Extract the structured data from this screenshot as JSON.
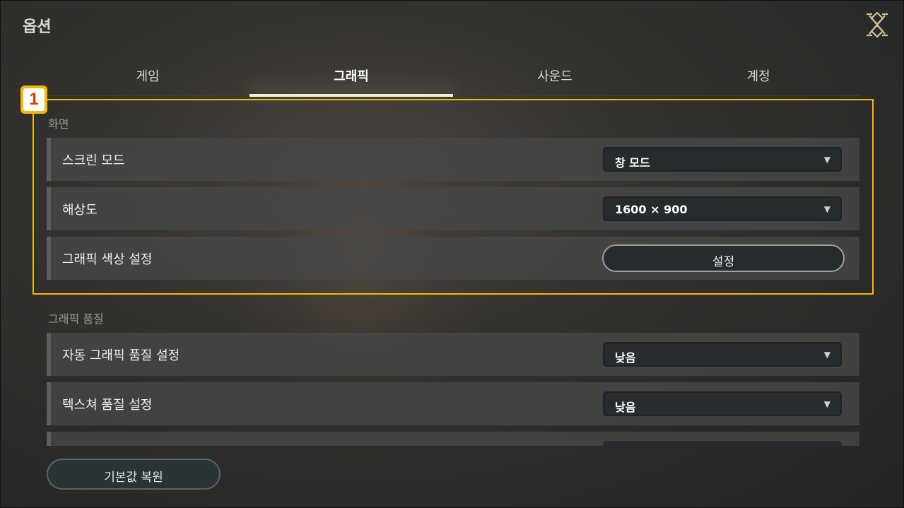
{
  "window": {
    "title": "옵션"
  },
  "icons": {
    "close": "close-icon"
  },
  "tabs": [
    {
      "label": "게임",
      "active": false
    },
    {
      "label": "그래픽",
      "active": true
    },
    {
      "label": "사운드",
      "active": false
    },
    {
      "label": "계정",
      "active": false
    }
  ],
  "annotation": {
    "badge_number": "1",
    "highlight_color": "#f5b800"
  },
  "sections": {
    "screen": {
      "title": "화면",
      "rows": [
        {
          "label": "스크린 모드",
          "control": "dropdown",
          "value": "창 모드"
        },
        {
          "label": "해상도",
          "control": "dropdown",
          "value": "1600 × 900"
        },
        {
          "label": "그래픽 색상 설정",
          "control": "button",
          "value": "설정"
        }
      ]
    },
    "quality": {
      "title": "그래픽 품질",
      "rows": [
        {
          "label": "자동 그래픽 품질 설정",
          "control": "dropdown",
          "value": "낮음"
        },
        {
          "label": "텍스쳐 품질 설정",
          "control": "dropdown",
          "value": "낮음"
        }
      ]
    }
  },
  "footer": {
    "reset_label": "기본값 복원"
  }
}
